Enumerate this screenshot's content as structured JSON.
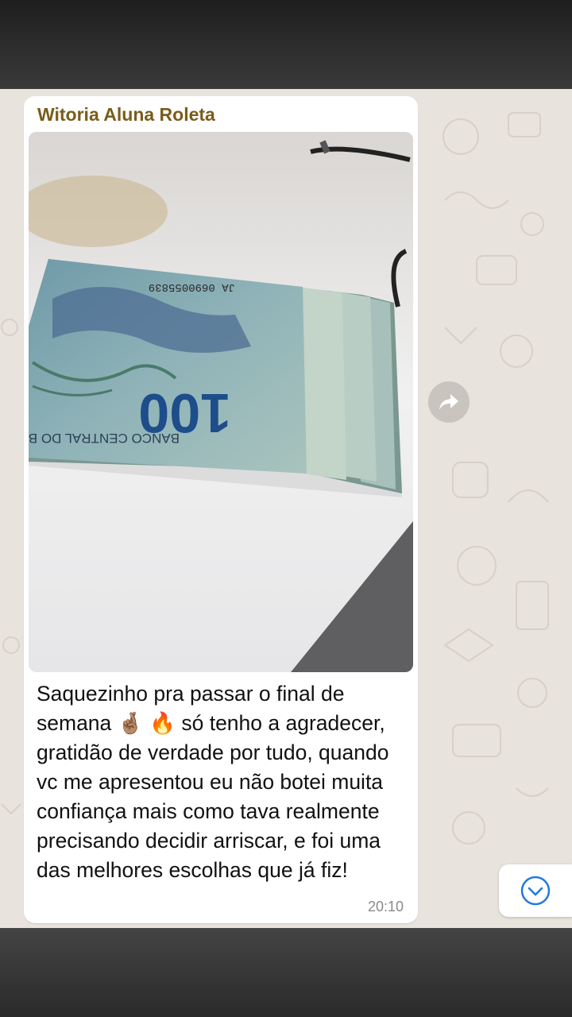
{
  "message": {
    "sender": "Witoria Aluna Roleta",
    "caption": "Saquezinho pra passar o final de semana 🤞🏽 🔥 só tenho a agradecer, gratidão de verdade por tudo, quando vc me apresentou eu não botei muita confiança mais como tava realmente precisando decidir arriscar, e foi uma das melhores escolhas que já fiz!",
    "time": "20:10"
  },
  "photo": {
    "note_value": "100",
    "serial": "JA 0690055839",
    "issuer": "BANCO CENTRAL DO BRASIL"
  },
  "icons": {
    "forward": "forward-arrow-icon",
    "scroll_down": "chevron-down-circle-icon"
  },
  "colors": {
    "sender_name": "#7a5c1a",
    "bubble": "#ffffff",
    "wallpaper": "#e8e3dc",
    "accent_blue": "#1f7ae0"
  }
}
